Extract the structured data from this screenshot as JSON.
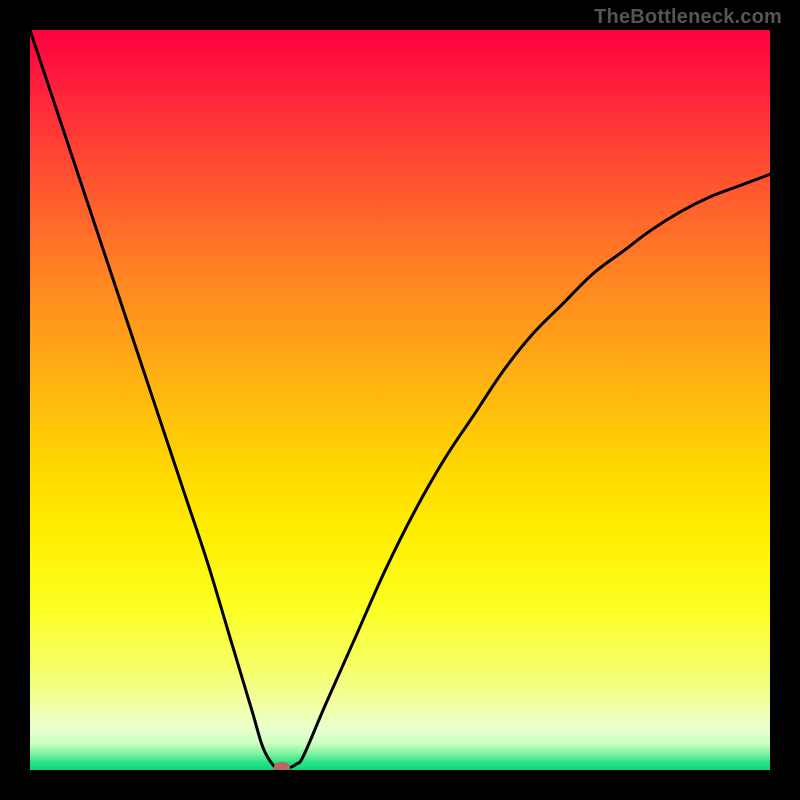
{
  "watermark": "TheBottleneck.com",
  "colors": {
    "black": "#000000",
    "curve": "#000000",
    "marker": "#b56a63"
  },
  "chart_data": {
    "type": "line",
    "title": "",
    "xlabel": "",
    "ylabel": "",
    "xlim": [
      0,
      100
    ],
    "ylim": [
      0,
      100
    ],
    "x": [
      0,
      3,
      6,
      9,
      12,
      15,
      18,
      21,
      24,
      27,
      30,
      31.5,
      33,
      34,
      35,
      36,
      37,
      40,
      44,
      48,
      52,
      56,
      60,
      64,
      68,
      72,
      76,
      80,
      84,
      88,
      92,
      96,
      100
    ],
    "y": [
      100,
      91,
      82,
      73,
      64,
      55,
      46,
      37,
      28,
      18,
      8,
      3,
      0.5,
      0.2,
      0.3,
      0.8,
      2,
      9,
      18,
      27,
      35,
      42,
      48,
      54,
      59,
      63,
      67,
      70,
      73,
      75.5,
      77.5,
      79,
      80.5
    ],
    "marker": {
      "x": 34,
      "y": 0.3,
      "color": "#b56a63"
    },
    "background_gradient_top_to_bottom": [
      {
        "stop": 0.0,
        "color": "#ff0040"
      },
      {
        "stop": 0.1,
        "color": "#ff2a3a"
      },
      {
        "stop": 0.22,
        "color": "#ff5a2e"
      },
      {
        "stop": 0.35,
        "color": "#ff8a20"
      },
      {
        "stop": 0.48,
        "color": "#ffb412"
      },
      {
        "stop": 0.58,
        "color": "#ffd400"
      },
      {
        "stop": 0.68,
        "color": "#ffee00"
      },
      {
        "stop": 0.78,
        "color": "#fbff22"
      },
      {
        "stop": 0.86,
        "color": "#f6ff66"
      },
      {
        "stop": 0.91,
        "color": "#f2ffa0"
      },
      {
        "stop": 0.945,
        "color": "#eaffd0"
      },
      {
        "stop": 0.965,
        "color": "#c8ffc0"
      },
      {
        "stop": 0.978,
        "color": "#7cf29f"
      },
      {
        "stop": 0.988,
        "color": "#2fe38a"
      },
      {
        "stop": 1.0,
        "color": "#0ed87c"
      }
    ]
  }
}
